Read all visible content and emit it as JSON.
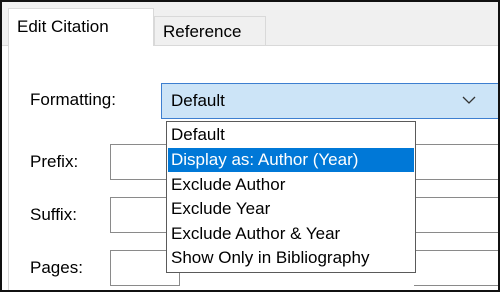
{
  "tabs": [
    {
      "label": "Edit Citation",
      "active": true
    },
    {
      "label": "Reference",
      "active": false
    }
  ],
  "form": {
    "formatting_label": "Formatting:",
    "formatting_value": "Default",
    "prefix_label": "Prefix:",
    "suffix_label": "Suffix:",
    "pages_label": "Pages:"
  },
  "dropdown": {
    "options": [
      "Default",
      "Display as: Author (Year)",
      "Exclude Author",
      "Exclude Year",
      "Exclude Author & Year",
      "Show Only in Bibliography"
    ],
    "highlighted_option": "Display as: Author (Year)"
  },
  "colors": {
    "highlight": "#0078d7",
    "combo_background": "#cce4f7",
    "combo_border": "#3d7fd0"
  },
  "icons": {
    "combo_arrow": "chevron-down-icon"
  }
}
